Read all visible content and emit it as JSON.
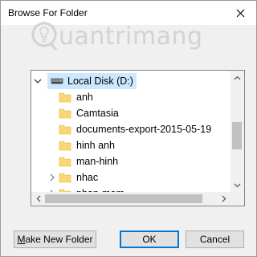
{
  "dialog": {
    "title": "Browse For Folder",
    "close_icon": "close-icon"
  },
  "watermark": {
    "text": "uantrimang"
  },
  "tree": {
    "root": {
      "label": "Local Disk (D:)",
      "icon": "drive-icon",
      "expanded": true,
      "selected": true
    },
    "items": [
      {
        "label": "anh",
        "icon": "folder-icon",
        "has_children": false
      },
      {
        "label": "Camtasia",
        "icon": "folder-icon",
        "has_children": false
      },
      {
        "label": "documents-export-2015-05-19",
        "icon": "folder-icon",
        "has_children": false
      },
      {
        "label": "hinh anh",
        "icon": "folder-icon",
        "has_children": false
      },
      {
        "label": "man-hinh",
        "icon": "folder-icon",
        "has_children": false
      },
      {
        "label": "nhac",
        "icon": "folder-icon",
        "has_children": true
      },
      {
        "label": "phan-mem",
        "icon": "folder-icon",
        "has_children": true
      }
    ]
  },
  "buttons": {
    "make_new_folder": "Make New Folder",
    "make_new_folder_rest": "ake New Folder",
    "make_new_folder_mnemonic": "M",
    "ok": "OK",
    "cancel": "Cancel"
  },
  "colors": {
    "selection": "#cce8ff",
    "folder": "#f8d775",
    "accent": "#0078d7"
  }
}
